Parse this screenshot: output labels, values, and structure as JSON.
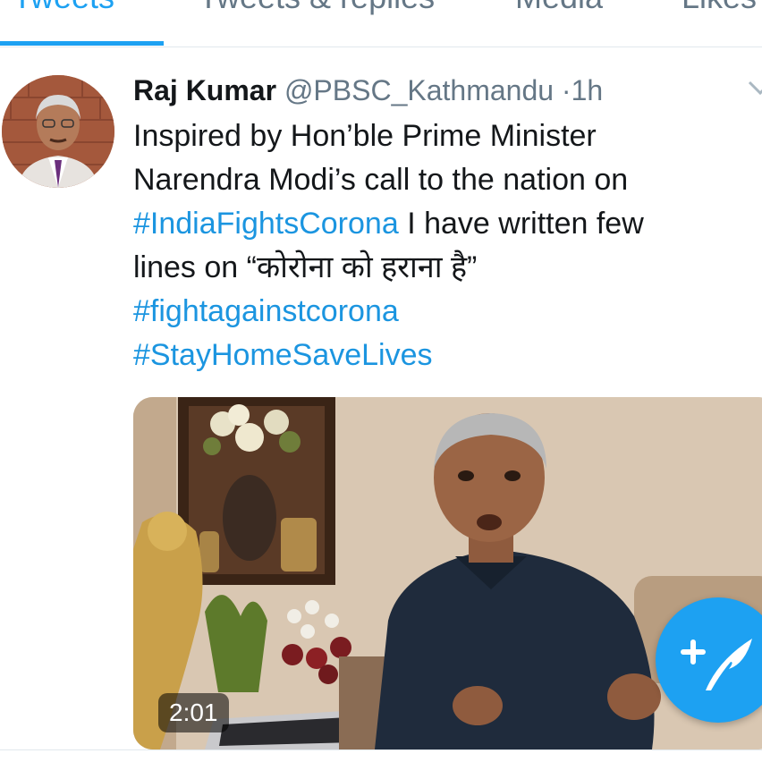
{
  "tabs": [
    {
      "label": "Tweets",
      "active": true
    },
    {
      "label": "Tweets & replies",
      "active": false
    },
    {
      "label": "Media",
      "active": false
    },
    {
      "label": "Likes",
      "active": false
    }
  ],
  "tweet": {
    "author_name": "Raj Kumar",
    "handle": "@PBSC_Kathmandu",
    "separator": "·",
    "time": "1h",
    "lines": [
      {
        "text": "Inspired by Hon’ble Prime Minister"
      },
      {
        "text": "Narendra Modi’s call to the nation on"
      },
      {
        "hashtag": "#IndiaFightsCorona",
        "text": " I have written few"
      },
      {
        "text": "lines on “कोरोना को हराना है”"
      },
      {
        "hashtag": "#fightagainstcorona"
      },
      {
        "hashtag": "#StayHomeSaveLives"
      }
    ],
    "video": {
      "duration": "2:01"
    }
  },
  "icons": {
    "menu": "chevron-down-icon",
    "compose": "compose-tweet-icon"
  },
  "colors": {
    "accent": "#1da1f2",
    "link": "#1b95e0",
    "secondary_text": "#657786"
  }
}
